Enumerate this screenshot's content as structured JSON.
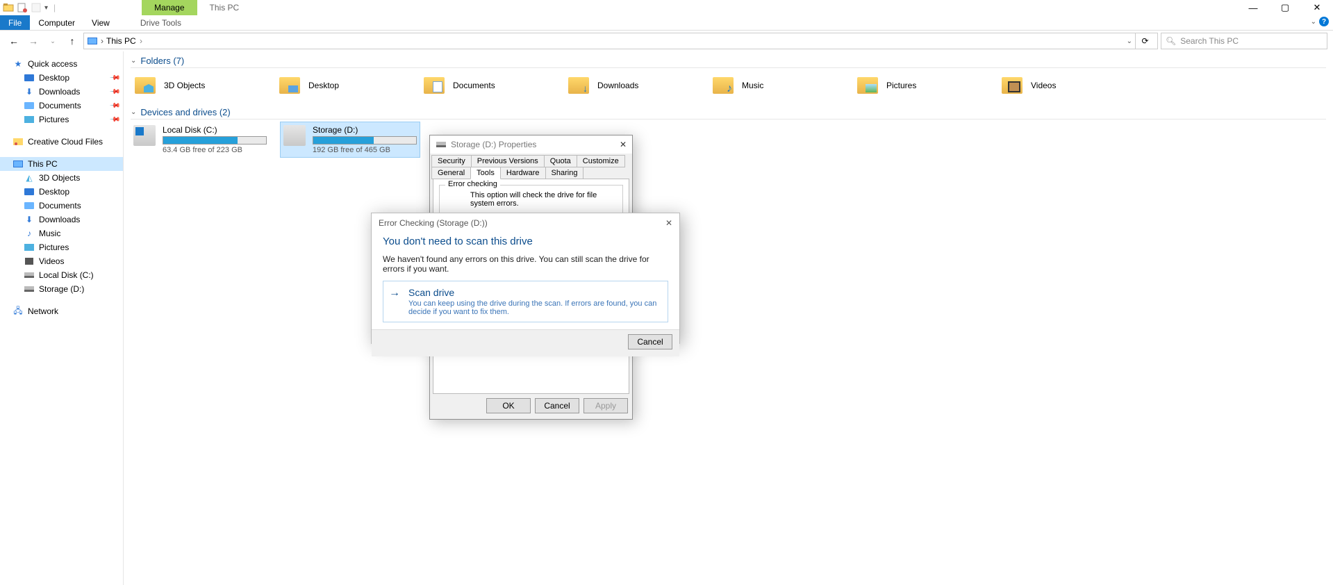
{
  "titlebar": {
    "manage": "Manage",
    "app_title": "This PC"
  },
  "ribbon": {
    "file": "File",
    "computer": "Computer",
    "view": "View",
    "drive_tools": "Drive Tools"
  },
  "address": {
    "crumb1": "This PC"
  },
  "search": {
    "placeholder": "Search This PC"
  },
  "sidebar": {
    "quick_access": "Quick access",
    "desktop": "Desktop",
    "downloads": "Downloads",
    "documents": "Documents",
    "pictures": "Pictures",
    "creative_cloud": "Creative Cloud Files",
    "this_pc": "This PC",
    "s3d": "3D Objects",
    "sdesktop": "Desktop",
    "sdocuments": "Documents",
    "sdownloads": "Downloads",
    "smusic": "Music",
    "spictures": "Pictures",
    "svideos": "Videos",
    "slocal": "Local Disk (C:)",
    "sstorage": "Storage (D:)",
    "network": "Network"
  },
  "sections": {
    "folders": "Folders (7)",
    "drives": "Devices and drives (2)"
  },
  "folders": {
    "a": "3D Objects",
    "b": "Desktop",
    "c": "Documents",
    "d": "Downloads",
    "e": "Music",
    "f": "Pictures",
    "g": "Videos"
  },
  "drives": {
    "c_name": "Local Disk (C:)",
    "c_free": "63.4 GB free of 223 GB",
    "c_fill_pct": 72,
    "d_name": "Storage (D:)",
    "d_free": "192 GB free of 465 GB",
    "d_fill_pct": 59
  },
  "properties": {
    "title": "Storage (D:) Properties",
    "tabs": {
      "security": "Security",
      "previous": "Previous Versions",
      "quota": "Quota",
      "customize": "Customize",
      "general": "General",
      "tools": "Tools",
      "hardware": "Hardware",
      "sharing": "Sharing"
    },
    "group": "Error checking",
    "desc": "This option will check the drive for file system errors.",
    "ok": "OK",
    "cancel": "Cancel",
    "apply": "Apply"
  },
  "errordlg": {
    "title": "Error Checking (Storage (D:))",
    "headline": "You don't need to scan this drive",
    "body": "We haven't found any errors on this drive. You can still scan the drive for errors if you want.",
    "cl_title": "Scan drive",
    "cl_sub": "You can keep using the drive during the scan. If errors are found, you can decide if you want to fix them.",
    "cancel": "Cancel"
  }
}
